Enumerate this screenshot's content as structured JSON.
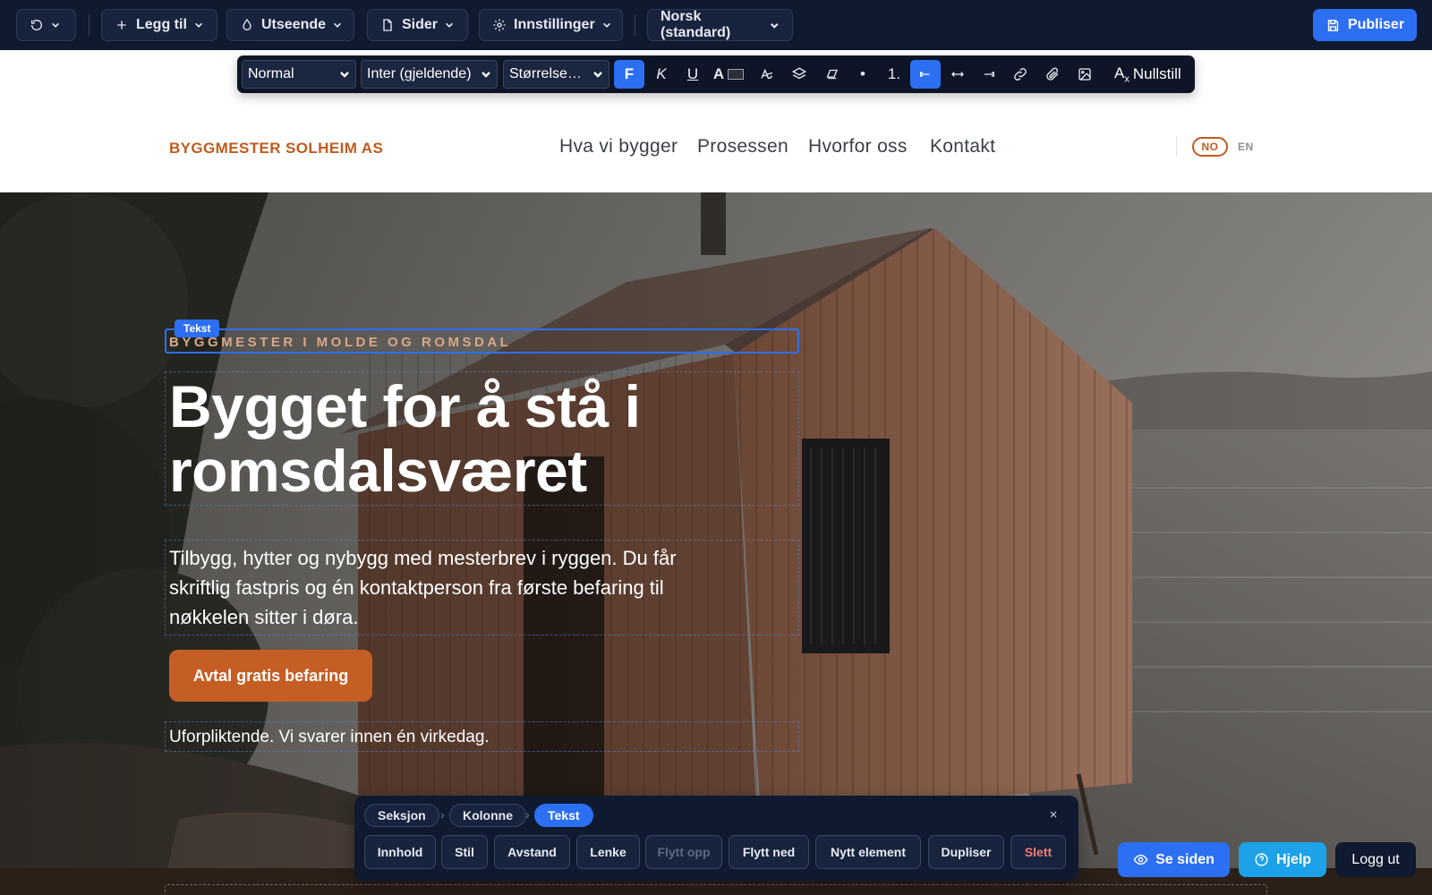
{
  "topbar": {
    "undo_icon": "undo-icon",
    "add_label": "Legg til",
    "appearance_label": "Utseende",
    "pages_label": "Sider",
    "settings_label": "Innstillinger",
    "language_select": "Norsk (standard)",
    "publish_label": "Publiser"
  },
  "rte": {
    "block_style": "Normal",
    "font": "Inter (gjeldende)",
    "size": "Størrelse…",
    "bold": "F",
    "italic": "K",
    "underline": "U",
    "text_color": "A",
    "ordered_list": "1.",
    "bullet_list": "•",
    "clear_label": "Nullstill"
  },
  "site": {
    "brand": "BYGGMESTER SOLHEIM AS",
    "nav": [
      "Hva vi bygger",
      "Prosessen",
      "Hvorfor oss",
      "Kontakt"
    ],
    "lang_active": "NO",
    "lang_other": "EN"
  },
  "hero": {
    "selection_tag": "Tekst",
    "eyebrow": "BYGGMESTER I MOLDE OG ROMSDAL",
    "headline_line1": "Bygget for å stå i",
    "headline_line2": "romsdalsværet",
    "lead": "Tilbygg, hytter og nybygg med mesterbrev i ryggen. Du får skriftlig fastpris og én kontaktperson fra første befaring til nøkkelen sitter i døra.",
    "cta_label": "Avtal gratis befaring",
    "note": "Uforpliktende. Vi svarer innen én virkedag."
  },
  "panel": {
    "crumbs": [
      "Seksjon",
      "Kolonne",
      "Tekst"
    ],
    "crumb_sep": "›",
    "close": "×",
    "buttons": [
      "Innhold",
      "Stil",
      "Avstand",
      "Lenke",
      "Flytt opp",
      "Flytt ned",
      "Nytt element",
      "Dupliser",
      "Slett"
    ]
  },
  "floating": {
    "view_label": "Se siden",
    "help_label": "Hjelp",
    "logout_label": "Logg ut"
  },
  "colors": {
    "admin_bg": "#0f1a30",
    "accent_blue": "#2d6ff2",
    "brand_orange": "#bf5b1e",
    "cta_orange": "#c55e24",
    "help_cyan": "#1da1e8"
  }
}
